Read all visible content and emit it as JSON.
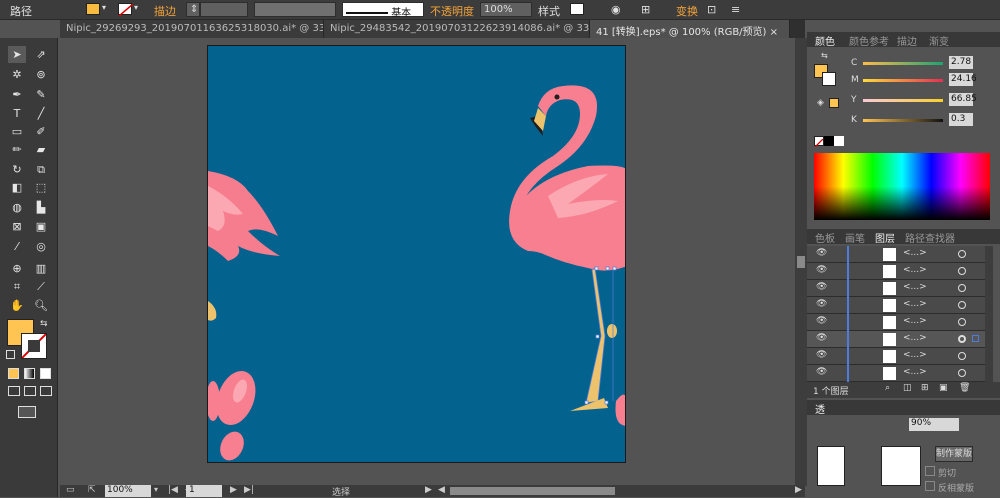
{
  "control_bar": {
    "object_type": "路径",
    "stroke_label": "描边",
    "stroke_profile": "基本",
    "opacity_label": "不透明度",
    "opacity_value": "100%",
    "style_label": "样式",
    "transform_label": "变换",
    "fill_color": "#f9bb3f"
  },
  "doc_tabs": [
    {
      "label": "Nipic_29269293_20190701163625318030.ai* @ 33...",
      "close": "×"
    },
    {
      "label": "Nipic_29483542_20190703122623914086.ai* @ 33...",
      "close": "×"
    },
    {
      "label": "41 [转换].eps* @ 100% (RGB/预览)",
      "close": "×"
    }
  ],
  "tools": {
    "fill_color": "#ffc452",
    "stroke_color": "#ffffff"
  },
  "artboard": {
    "background": "#04628f",
    "flamingo_pink": "#f77f8f",
    "leg_color": "#ecc36c"
  },
  "status_bar": {
    "zoom": "100%",
    "page": "1",
    "tool_name": "选择"
  },
  "color_panel": {
    "tabs": [
      "颜色",
      "颜色参考",
      "描边",
      "渐变"
    ],
    "channels": [
      {
        "label": "C",
        "value": "2.78"
      },
      {
        "label": "M",
        "value": "24.16"
      },
      {
        "label": "Y",
        "value": "66.85"
      },
      {
        "label": "K",
        "value": "0.3"
      }
    ]
  },
  "layers_panel": {
    "tabs": [
      "色板",
      "画笔",
      "图层",
      "路径查找器"
    ],
    "rows": [
      {
        "name": "<...>"
      },
      {
        "name": "<...>"
      },
      {
        "name": "<...>"
      },
      {
        "name": "<...>"
      },
      {
        "name": "<...>"
      },
      {
        "name": "<...>"
      },
      {
        "name": "<...>"
      },
      {
        "name": "<...>"
      }
    ],
    "footer": "1 个图层"
  },
  "transparency_panel": {
    "title": "透",
    "opacity_value": "90%",
    "mask_button": "制作蒙版",
    "clip_label": "剪切",
    "invert_label": "反相蒙版"
  }
}
